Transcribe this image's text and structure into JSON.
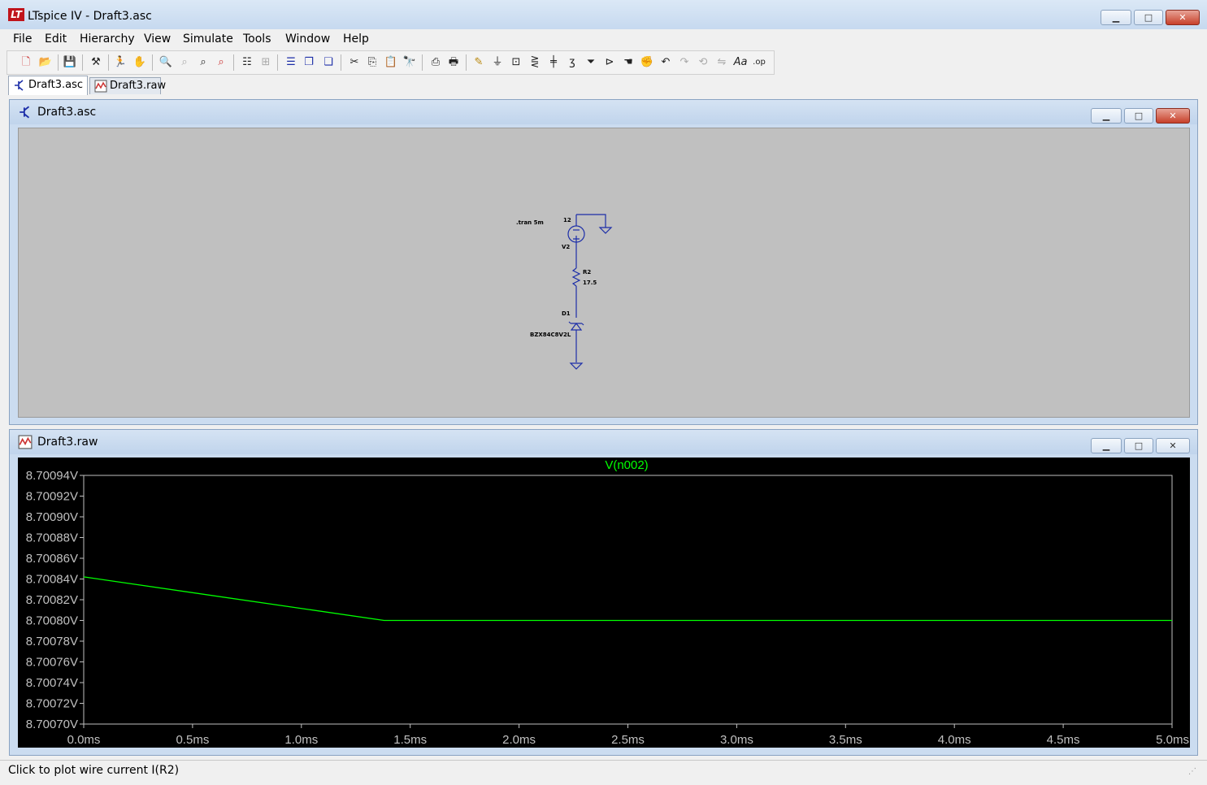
{
  "window": {
    "title": "LTspice IV - Draft3.asc",
    "logo": "LT",
    "minimize_label": "▁",
    "maximize_label": "□",
    "close_label": "✕"
  },
  "menu": [
    "File",
    "Edit",
    "Hierarchy",
    "View",
    "Simulate",
    "Tools",
    "Window",
    "Help"
  ],
  "toolbar_icons": [
    "new-schematic-icon",
    "open-icon",
    "save-icon",
    "control-panel-icon",
    "run-icon",
    "halt-icon",
    "zoom-in-icon",
    "zoom-box-icon",
    "zoom-out-icon",
    "zoom-fit-icon",
    "autorange-icon",
    "add-plot-pane-icon",
    "tile-horizontal-icon",
    "cascade-icon",
    "tile-vertical-icon",
    "cut-icon",
    "copy-icon",
    "paste-icon",
    "find-icon",
    "print-setup-icon",
    "print-icon",
    "draw-wire-icon",
    "ground-icon",
    "label-net-icon",
    "resistor-icon",
    "capacitor-icon",
    "inductor-icon",
    "diode-icon",
    "component-icon",
    "move-icon",
    "drag-icon",
    "undo-icon",
    "redo-icon",
    "rotate-icon",
    "mirror-icon",
    "text-icon",
    "spice-directive-icon"
  ],
  "tabs": [
    {
      "label": "Draft3.asc",
      "icon": "schematic-icon",
      "active": true
    },
    {
      "label": "Draft3.raw",
      "icon": "waveform-icon",
      "active": false
    }
  ],
  "schematic": {
    "title": "Draft3.asc",
    "directive": ".tran 5m",
    "source_value": "12",
    "source_name": "V2",
    "resistor_name": "R2",
    "resistor_value": "17.5",
    "diode_name": "D1",
    "diode_model": "BZX84C8V2L",
    "wire_color": "#1c2ea8"
  },
  "waveform": {
    "title": "Draft3.raw",
    "trace_color": "#00ff00"
  },
  "chart_data": {
    "type": "line",
    "title": "V(n002)",
    "series": [
      {
        "name": "V(n002)",
        "x": [
          0.0,
          1.38,
          5.0
        ],
        "y": [
          8.700842,
          8.7008,
          8.7008
        ]
      }
    ],
    "x_unit": "ms",
    "y_unit": "V",
    "xlim": [
      0.0,
      5.0
    ],
    "ylim": [
      8.7007,
      8.70094
    ],
    "x_ticks": [
      "0.0ms",
      "0.5ms",
      "1.0ms",
      "1.5ms",
      "2.0ms",
      "2.5ms",
      "3.0ms",
      "3.5ms",
      "4.0ms",
      "4.5ms",
      "5.0ms"
    ],
    "y_ticks": [
      "8.70094V",
      "8.70092V",
      "8.70090V",
      "8.70088V",
      "8.70086V",
      "8.70084V",
      "8.70082V",
      "8.70080V",
      "8.70078V",
      "8.70076V",
      "8.70074V",
      "8.70072V",
      "8.70070V"
    ],
    "grid": false,
    "background": "#000000",
    "axis_color": "#c0c0c0",
    "label_color": "#c0c0c0"
  },
  "status": {
    "text": "Click to plot wire current I(R2)"
  }
}
